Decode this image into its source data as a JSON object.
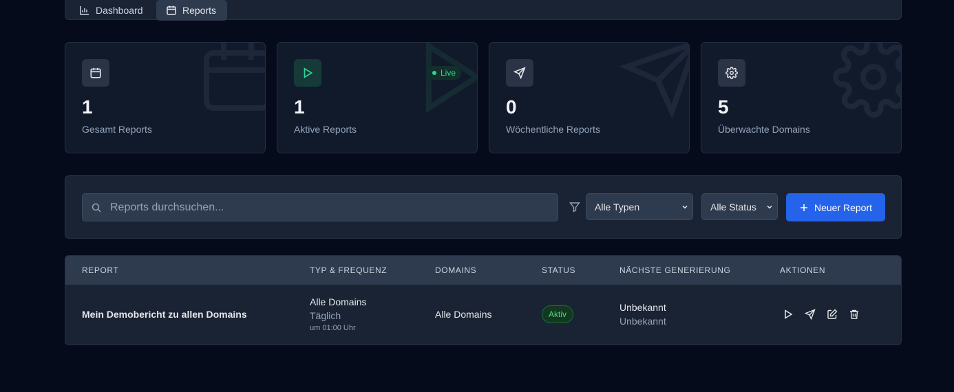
{
  "tabs": [
    {
      "label": "Dashboard",
      "icon": "bar-chart-icon"
    },
    {
      "label": "Reports",
      "icon": "calendar-icon",
      "active": true
    }
  ],
  "stats": [
    {
      "value": "1",
      "label": "Gesamt Reports",
      "icon": "calendar-icon"
    },
    {
      "value": "1",
      "label": "Aktive Reports",
      "icon": "play-icon",
      "badge": "Live"
    },
    {
      "value": "0",
      "label": "Wöchentliche Reports",
      "icon": "send-icon"
    },
    {
      "value": "5",
      "label": "Überwachte Domains",
      "icon": "gear-icon"
    }
  ],
  "filters": {
    "search_placeholder": "Reports durchsuchen...",
    "type_select": "Alle Typen",
    "status_select": "Alle Status",
    "new_button": "Neuer Report"
  },
  "table": {
    "headers": [
      "REPORT",
      "TYP & FREQUENZ",
      "DOMAINS",
      "STATUS",
      "NÄCHSTE GENERIERUNG",
      "AKTIONEN"
    ],
    "rows": [
      {
        "report": "Mein Demobericht zu allen Domains",
        "type": "Alle Domains",
        "frequency": "Täglich",
        "time": "um 01:00 Uhr",
        "domains": "Alle Domains",
        "status": "Aktiv",
        "next_primary": "Unbekannt",
        "next_secondary": "Unbekannt"
      }
    ]
  },
  "colors": {
    "background": "#050b1a",
    "accent": "#2563eb",
    "success": "#4ade80",
    "live": "#34d399"
  }
}
